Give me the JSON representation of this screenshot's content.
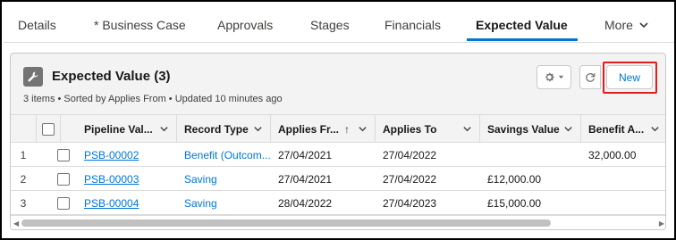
{
  "tabs": [
    {
      "label": "Details"
    },
    {
      "label": "* Business Case"
    },
    {
      "label": "Approvals"
    },
    {
      "label": "Stages"
    },
    {
      "label": "Financials"
    },
    {
      "label": "Expected Value"
    }
  ],
  "more_label": "More",
  "card": {
    "title": "Expected Value (3)",
    "subtitle": "3 items • Sorted by Applies From • Updated 10 minutes ago",
    "new_label": "New",
    "highlight_color": "#e01e1e"
  },
  "table": {
    "columns": [
      {
        "label": "Pipeline Val..."
      },
      {
        "label": "Record Type"
      },
      {
        "label": "Applies Fr...",
        "sort": "↑"
      },
      {
        "label": "Applies To"
      },
      {
        "label": "Savings Value"
      },
      {
        "label": "Benefit A..."
      }
    ],
    "rows": [
      {
        "num": "1",
        "pipeline": "PSB-00002",
        "record_type": "Benefit (Outcom...",
        "applies_from": "27/04/2021",
        "applies_to": "27/04/2022",
        "savings": "",
        "benefit": "32,000.00"
      },
      {
        "num": "2",
        "pipeline": "PSB-00003",
        "record_type": "Saving",
        "applies_from": "27/04/2021",
        "applies_to": "27/04/2022",
        "savings": "£12,000.00",
        "benefit": ""
      },
      {
        "num": "3",
        "pipeline": "PSB-00004",
        "record_type": "Saving",
        "applies_from": "28/04/2022",
        "applies_to": "27/04/2023",
        "savings": "£15,000.00",
        "benefit": ""
      }
    ]
  },
  "colors": {
    "accent": "#0176d3",
    "border": "#dddbda"
  }
}
